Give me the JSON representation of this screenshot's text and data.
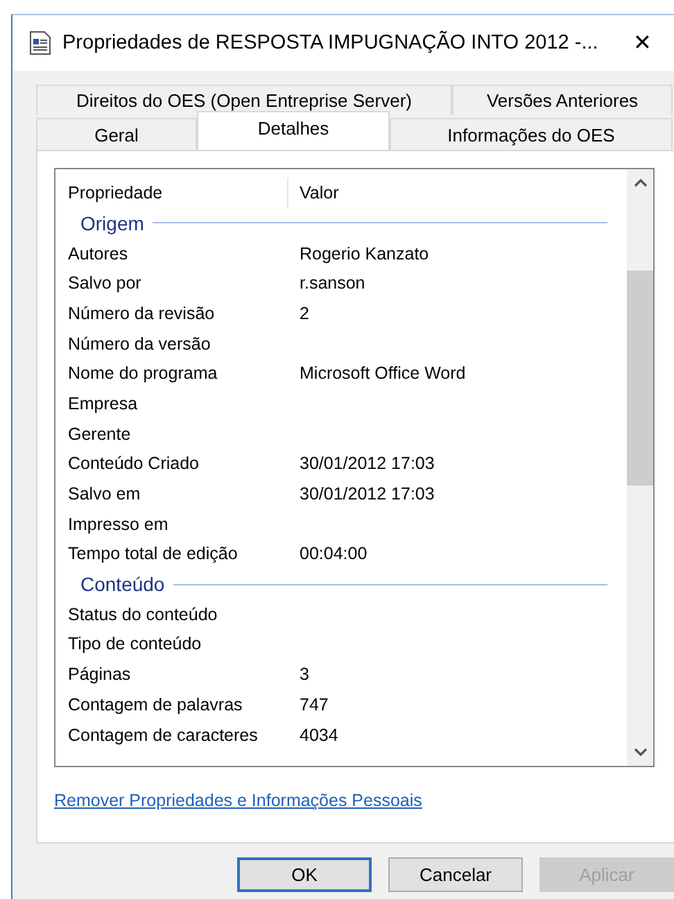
{
  "window": {
    "title": "Propriedades de RESPOSTA IMPUGNAÇÃO INTO 2012 -...",
    "close": "✕"
  },
  "tab_rows": [
    [
      {
        "label": "Direitos do OES (Open Entreprise Server)",
        "selected": false
      },
      {
        "label": "Versões Anteriores",
        "selected": false
      }
    ],
    [
      {
        "label": "Geral",
        "selected": false
      },
      {
        "label": "Detalhes",
        "selected": true
      },
      {
        "label": "Informações do OES",
        "selected": false
      }
    ]
  ],
  "table": {
    "columns": [
      "Propriedade",
      "Valor"
    ],
    "rows": [
      {
        "kind": "group",
        "label": "Origem"
      },
      {
        "kind": "prop",
        "name": "Autores",
        "value": "Rogerio Kanzato"
      },
      {
        "kind": "prop",
        "name": "Salvo por",
        "value": "r.sanson"
      },
      {
        "kind": "prop",
        "name": "Número da revisão",
        "value": "2"
      },
      {
        "kind": "prop",
        "name": "Número da versão"
      },
      {
        "kind": "prop",
        "name": "Nome do programa",
        "value": "Microsoft Office Word"
      },
      {
        "kind": "prop",
        "name": "Empresa"
      },
      {
        "kind": "prop",
        "name": "Gerente"
      },
      {
        "kind": "prop",
        "name": "Conteúdo Criado",
        "value": "30/01/2012 17:03"
      },
      {
        "kind": "prop",
        "name": "Salvo em",
        "value": "30/01/2012 17:03"
      },
      {
        "kind": "prop",
        "name": "Impresso em"
      },
      {
        "kind": "prop",
        "name": "Tempo total de edição",
        "value": "00:04:00"
      },
      {
        "kind": "group",
        "label": "Conteúdo"
      },
      {
        "kind": "prop",
        "name": "Status do conteúdo"
      },
      {
        "kind": "prop",
        "name": "Tipo de conteúdo"
      },
      {
        "kind": "prop",
        "name": "Páginas",
        "value": "3"
      },
      {
        "kind": "prop",
        "name": "Contagem de palavras",
        "value": "747"
      },
      {
        "kind": "prop",
        "name": "Contagem de caracteres",
        "value": "4034"
      }
    ]
  },
  "link": "Remover Propriedades e Informações Pessoais",
  "buttons": [
    {
      "label": "OK",
      "default": true,
      "disabled": false
    },
    {
      "label": "Cancelar",
      "default": false,
      "disabled": false
    },
    {
      "label": "Aplicar",
      "default": false,
      "disabled": true
    }
  ]
}
